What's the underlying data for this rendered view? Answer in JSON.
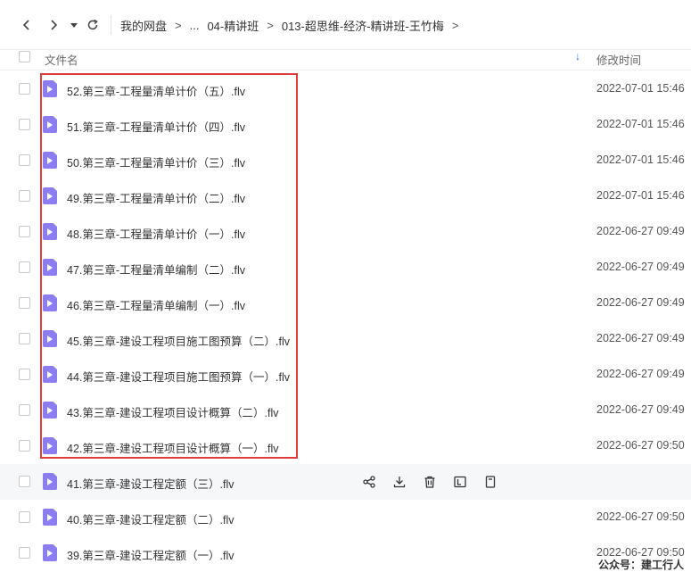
{
  "breadcrumb": {
    "items": [
      "我的网盘",
      "...",
      "04-精讲班",
      "013-超思维-经济-精讲班-王竹梅"
    ],
    "separator": ">"
  },
  "header": {
    "col_name": "文件名",
    "col_time": "修改时间",
    "sort_indicator": "↓"
  },
  "files": [
    {
      "name": "52.第三章-工程量清单计价（五）.flv",
      "time": "2022-07-01 15:46"
    },
    {
      "name": "51.第三章-工程量清单计价（四）.flv",
      "time": "2022-07-01 15:46"
    },
    {
      "name": "50.第三章-工程量清单计价（三）.flv",
      "time": "2022-07-01 15:46"
    },
    {
      "name": "49.第三章-工程量清单计价（二）.flv",
      "time": "2022-07-01 15:46"
    },
    {
      "name": "48.第三章-工程量清单计价（一）.flv",
      "time": "2022-06-27 09:49"
    },
    {
      "name": "47.第三章-工程量清单编制（二）.flv",
      "time": "2022-06-27 09:49"
    },
    {
      "name": "46.第三章-工程量清单编制（一）.flv",
      "time": "2022-06-27 09:49"
    },
    {
      "name": "45.第三章-建设工程项目施工图预算（二）.flv",
      "time": "2022-06-27 09:49"
    },
    {
      "name": "44.第三章-建设工程项目施工图预算（一）.flv",
      "time": "2022-06-27 09:49"
    },
    {
      "name": "43.第三章-建设工程项目设计概算（二）.flv",
      "time": "2022-06-27 09:49"
    },
    {
      "name": "42.第三章-建设工程项目设计概算（一）.flv",
      "time": "2022-06-27 09:50"
    },
    {
      "name": "41.第三章-建设工程定额（三）.flv",
      "time": ""
    },
    {
      "name": "40.第三章-建设工程定额（二）.flv",
      "time": "2022-06-27 09:50"
    },
    {
      "name": "39.第三章-建设工程定额（一）.flv",
      "time": "2022-06-27 09:50"
    }
  ],
  "row_actions": [
    "share-icon",
    "download-icon",
    "delete-icon",
    "rename-icon",
    "more-icon"
  ],
  "colors": {
    "accent": "#1a73e8",
    "file_icon": "#8b7cf0",
    "highlight": "#e03c3c",
    "hover_row": "#f6f7f9"
  },
  "watermark": "公众号：建工行人"
}
